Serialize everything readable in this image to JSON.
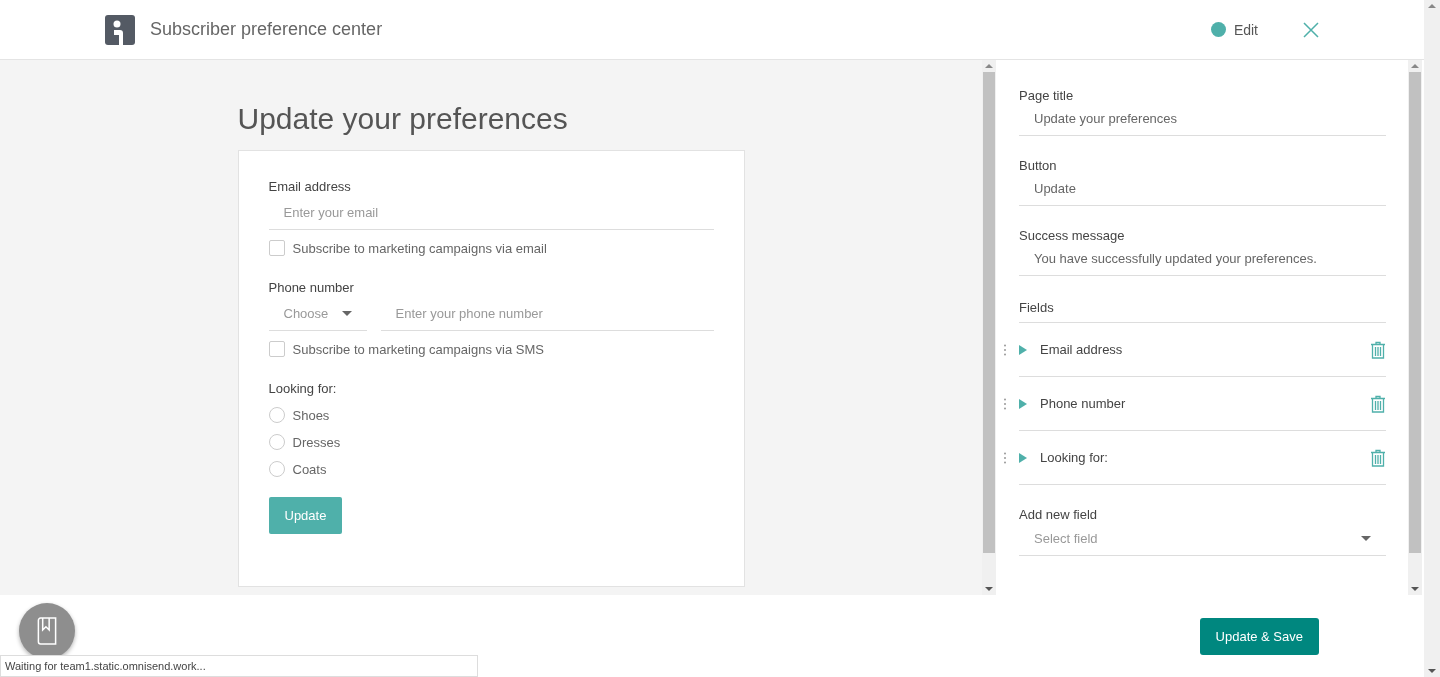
{
  "header": {
    "title": "Subscriber preference center",
    "mode_label": "Edit"
  },
  "preview": {
    "heading": "Update your preferences",
    "email": {
      "label": "Email address",
      "placeholder": "Enter your email",
      "consent": {
        "label": "Subscribe to marketing campaigns via email",
        "checked": false
      }
    },
    "phone": {
      "label": "Phone number",
      "country_placeholder": "Choose",
      "placeholder": "Enter your phone number",
      "consent": {
        "label": "Subscribe to marketing campaigns via SMS",
        "checked": false
      }
    },
    "looking_for": {
      "label": "Looking for:",
      "options": [
        {
          "label": "Shoes",
          "selected": false
        },
        {
          "label": "Dresses",
          "selected": false
        },
        {
          "label": "Coats",
          "selected": false
        }
      ]
    },
    "button": "Update"
  },
  "settings": {
    "settings_fields": [
      {
        "label": "Page title",
        "value": "Update your preferences"
      },
      {
        "label": "Button",
        "value": "Update"
      },
      {
        "label": "Success message",
        "value": "You have successfully updated your preferences."
      }
    ],
    "fields_heading": "Fields",
    "fields": [
      {
        "label": "Email address",
        "expanded": false
      },
      {
        "label": "Phone number",
        "expanded": false
      },
      {
        "label": "Looking for:",
        "expanded": false
      }
    ],
    "add_field": {
      "label": "Add new field",
      "placeholder": "Select field"
    }
  },
  "footer": {
    "save_button": "Update & Save"
  },
  "status_bar": "Waiting for team1.static.omnisend.work..."
}
